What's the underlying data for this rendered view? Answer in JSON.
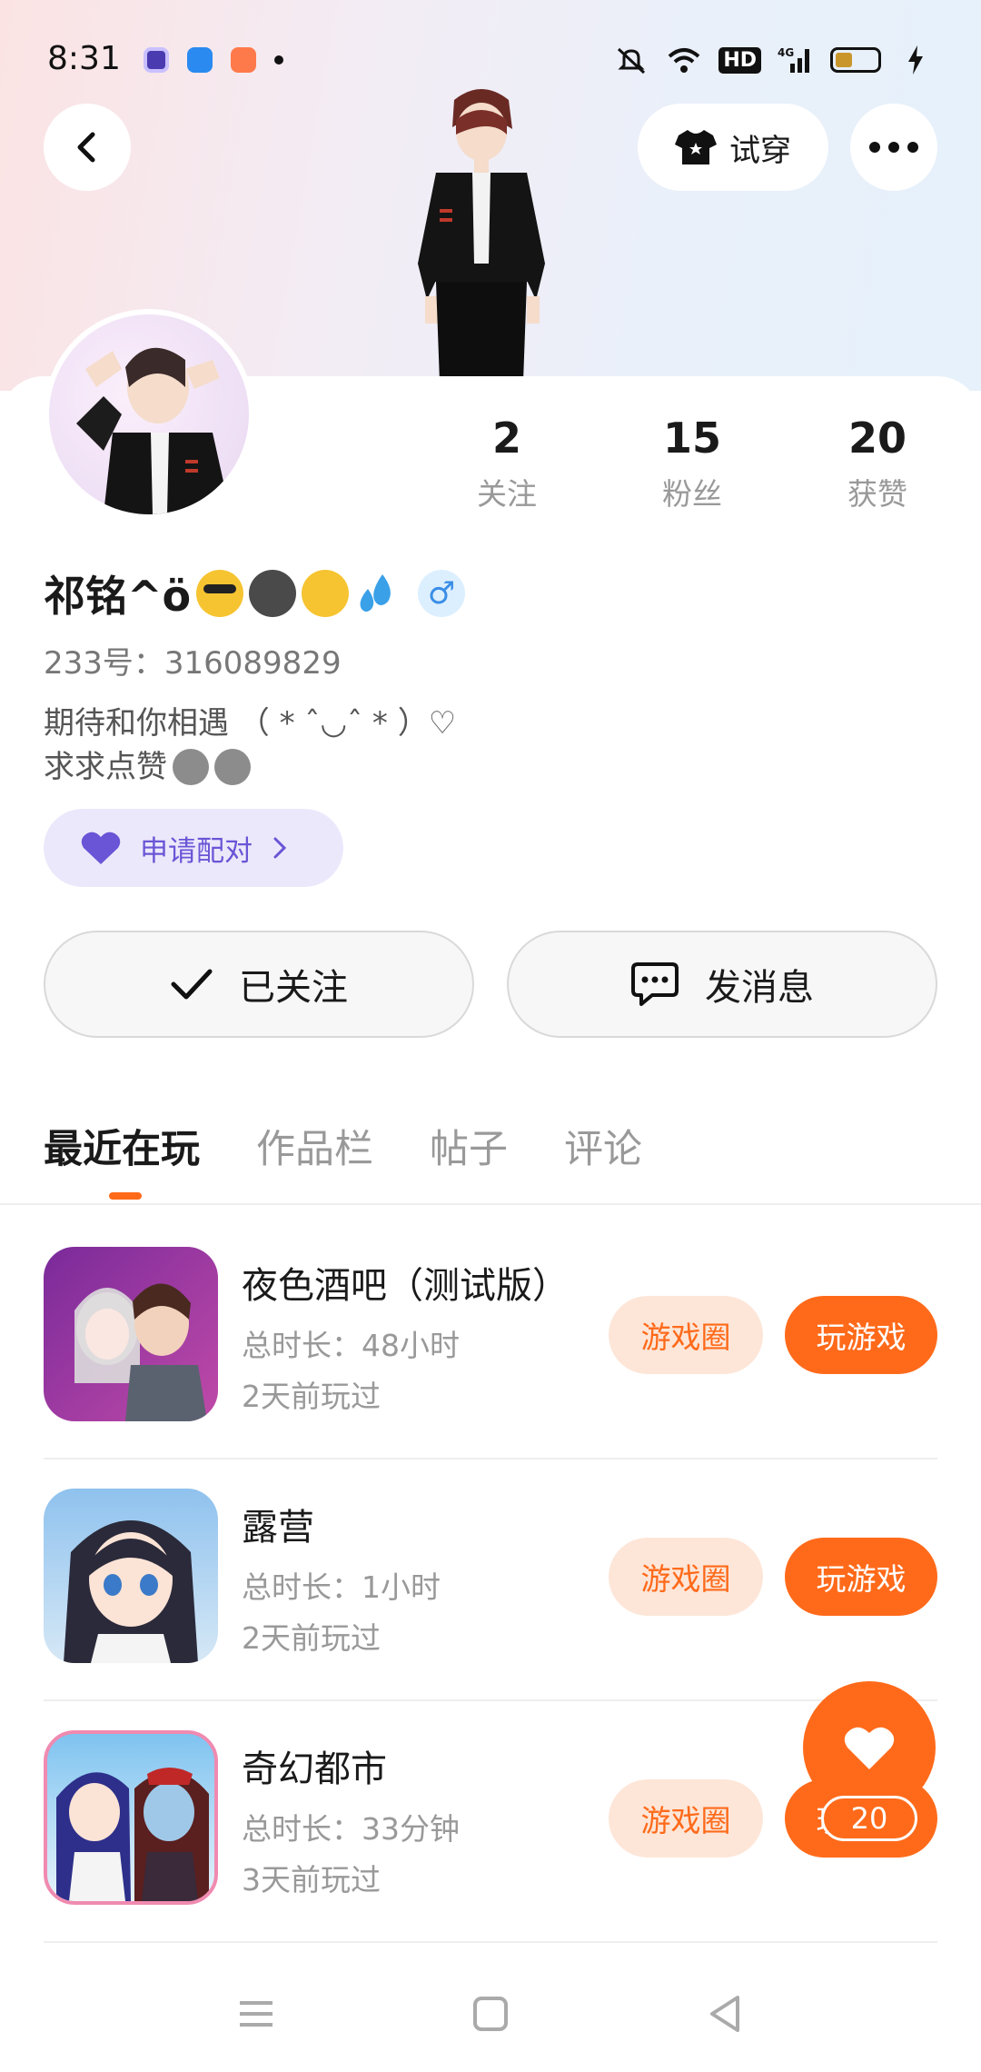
{
  "status_bar": {
    "time": "8:31",
    "app_icons": [
      "purple-app-icon",
      "blue-app-icon",
      "game-app-icon",
      "dot-icon"
    ],
    "right_icons": [
      "mute-icon",
      "wifi-icon",
      "hd-icon",
      "signal-4g-icon",
      "battery-icon",
      "charging-icon"
    ],
    "hd_label": "HD"
  },
  "header": {
    "back_icon": "chevron-left-icon",
    "try_on_label": "试穿",
    "more_icon": "more-dots-icon"
  },
  "profile": {
    "stats": [
      {
        "value": "2",
        "label": "关注"
      },
      {
        "value": "15",
        "label": "粉丝"
      },
      {
        "value": "20",
        "label": "获赞"
      }
    ],
    "name": "祁铭^ö",
    "gender_symbol": "♂",
    "uid": "233号：316089829",
    "bio_line1": "期待和你相遇 （ * ˆ◡ˆ * ）♡",
    "bio_line2": "求求点赞",
    "pair_button": "申请配对"
  },
  "actions": {
    "following_label": "已关注",
    "message_label": "发消息"
  },
  "tabs": [
    {
      "label": "最近在玩",
      "active": true
    },
    {
      "label": "作品栏",
      "active": false
    },
    {
      "label": "帖子",
      "active": false
    },
    {
      "label": "评论",
      "active": false
    }
  ],
  "games": [
    {
      "title": "夜色酒吧（测试版）",
      "duration": "总时长：48小时",
      "last_played": "2天前玩过",
      "circle_label": "游戏圈",
      "play_label": "玩游戏"
    },
    {
      "title": "露营",
      "duration": "总时长：1小时",
      "last_played": "2天前玩过",
      "circle_label": "游戏圈",
      "play_label": "玩游戏"
    },
    {
      "title": "奇幻都市",
      "duration": "总时长：33分钟",
      "last_played": "3天前玩过",
      "circle_label": "游戏圈",
      "play_label": "玩游戏"
    }
  ],
  "like_fab": {
    "count": "20"
  },
  "colors": {
    "accent": "#ff6a1a",
    "accent_soft": "#fde6d8",
    "pair_bg": "#ece8fb",
    "pair_text": "#6a55d6"
  }
}
